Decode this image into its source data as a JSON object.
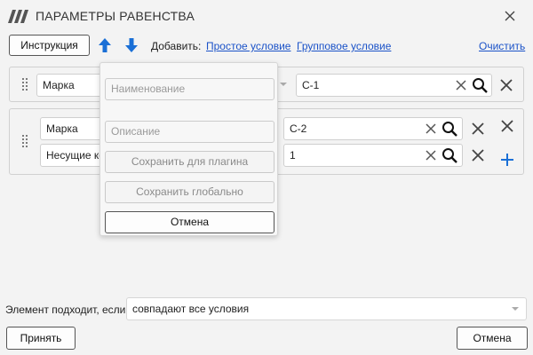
{
  "window": {
    "title": "ПАРАМЕТРЫ РАВЕНСТВА"
  },
  "toolbar": {
    "instructions_label": "Инструкция",
    "add_label": "Добавить:",
    "simple_condition_link": "Простое условие",
    "group_condition_link": "Групповое условие",
    "clear_link": "Очистить"
  },
  "conditions": {
    "row1": {
      "param": "Марка",
      "value": "С-1"
    },
    "group": {
      "rows": [
        {
          "param": "Марка",
          "value": "С-2"
        },
        {
          "param": "Несущие ко",
          "value": "1"
        }
      ]
    }
  },
  "save_popup": {
    "name_placeholder": "Наименование",
    "description_placeholder": "Описание",
    "save_plugin_label": "Сохранить для плагина",
    "save_global_label": "Сохранить глобально",
    "cancel_label": "Отмена"
  },
  "footer": {
    "match_label": "Элемент подходит, если",
    "match_value": "совпадают все условия",
    "ok_label": "Принять",
    "cancel_label": "Отмена"
  },
  "colors": {
    "accent": "#1a6fd6",
    "link": "#1a52c8",
    "background": "#f3f3f3"
  },
  "icons": [
    "app-logo-icon",
    "close-icon",
    "arrow-up-icon",
    "arrow-down-icon",
    "drag-grip-icon",
    "clear-icon",
    "search-icon",
    "delete-icon",
    "plus-icon",
    "chevron-down-icon"
  ]
}
